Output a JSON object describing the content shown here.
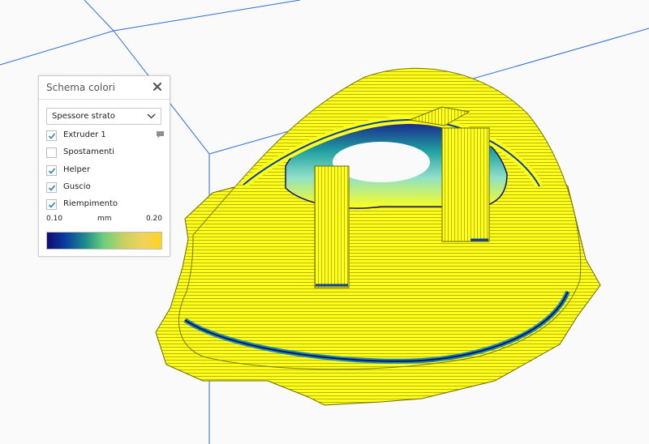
{
  "panel": {
    "title": "Schema colori",
    "mode": "Spessore strato",
    "options": [
      {
        "label": "Extruder 1",
        "checked": true
      },
      {
        "label": "Spostamenti",
        "checked": false
      },
      {
        "label": "Helper",
        "checked": true
      },
      {
        "label": "Guscio",
        "checked": true
      },
      {
        "label": "Riempimento",
        "checked": true
      }
    ],
    "legend": {
      "min": "0.10",
      "unit": "mm",
      "max": "0.20",
      "colors": [
        "#100a72",
        "#0a3fa0",
        "#1e8c8c",
        "#6fcf7c",
        "#c8d060",
        "#f0d260",
        "#ffd21e"
      ]
    }
  },
  "scene": {
    "print_color": "#ffff1a",
    "grid_color": "#2b6cd6",
    "build_plate_color": "#fafafa"
  }
}
